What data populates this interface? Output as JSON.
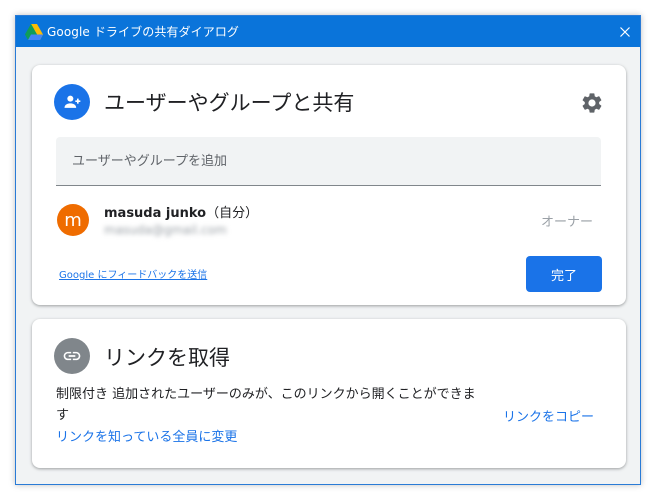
{
  "window": {
    "title": "Google ドライブの共有ダイアログ",
    "close_glyph": "✕",
    "accent": "#0a74da"
  },
  "share": {
    "heading": "ユーザーやグループと共有",
    "add_placeholder": "ユーザーやグループを追加",
    "user": {
      "avatar_letter": "m",
      "name": "masuda junko",
      "self_tag": "（自分）",
      "email": "masuda@gmail.com",
      "role": "オーナー"
    },
    "feedback_link": "Google にフィードバックを送信",
    "done_button": "完了"
  },
  "link": {
    "heading": "リンクを取得",
    "restriction": "制限付き",
    "description": "追加されたユーザーのみが、このリンクから開くことができます",
    "change_link": "リンクを知っている全員に変更",
    "copy_link": "リンクをコピー"
  },
  "icons": {
    "app": "google-drive-icon",
    "share": "person-add-icon",
    "settings": "gear-icon",
    "link": "link-icon",
    "close": "close-icon"
  },
  "colors": {
    "primary": "#1a73e8",
    "avatar": "#ef6c00",
    "link_circle": "#80868b"
  }
}
